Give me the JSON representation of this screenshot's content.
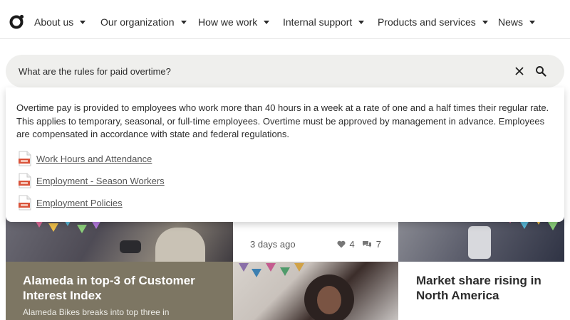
{
  "nav": {
    "logo_icon": "ring-logo-icon",
    "items": [
      {
        "label": "About us"
      },
      {
        "label": "Our organization"
      },
      {
        "label": "How we work"
      },
      {
        "label": "Internal support"
      },
      {
        "label": "Products and services"
      },
      {
        "label": "News"
      }
    ]
  },
  "search": {
    "value": "What are the rules for paid overtime?",
    "clear_icon": "close-icon",
    "search_icon": "search-icon"
  },
  "answer": {
    "text": "Overtime pay is provided to employees who work more than 40 hours in a week at a rate of one and a half times their regular rate. This applies to temporary, seasonal, or full-time employees. Overtime must be approved by management in advance. Employees are compensated in accordance with state and federal regulations.",
    "sources": [
      {
        "label": "Work Hours and Attendance",
        "icon": "pdf-document-icon"
      },
      {
        "label": "Employment - Season Workers",
        "icon": "pdf-document-icon"
      },
      {
        "label": "Employment Policies",
        "icon": "pdf-document-icon"
      }
    ]
  },
  "cards": {
    "news_card": {
      "age": "3 days ago",
      "likes": "4",
      "comments": "7"
    },
    "alameda": {
      "title": "Alameda in top-3 of Customer Interest Index",
      "subtitle": "Alameda Bikes breaks into top three in"
    },
    "market": {
      "title": "Market share rising in North America"
    }
  },
  "colors": {
    "accent_pdf": "#d9533a",
    "search_bg": "#efefed",
    "tile_olive": "#7d7663"
  }
}
